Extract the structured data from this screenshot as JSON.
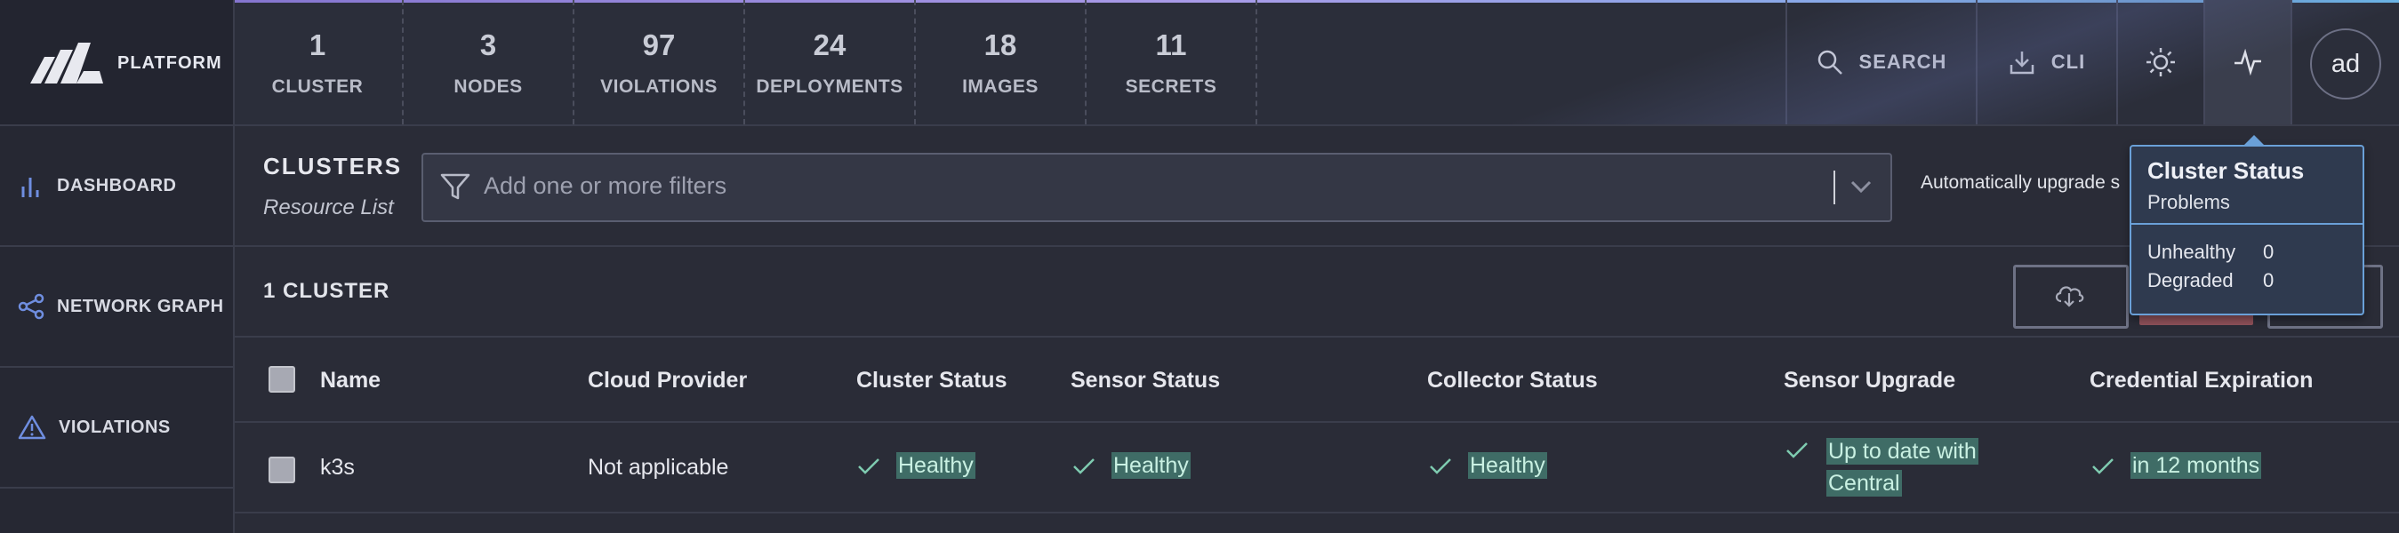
{
  "brand": {
    "label": "PLATFORM"
  },
  "summary": [
    {
      "count": "1",
      "label": "CLUSTER"
    },
    {
      "count": "3",
      "label": "NODES"
    },
    {
      "count": "97",
      "label": "VIOLATIONS"
    },
    {
      "count": "24",
      "label": "DEPLOYMENTS"
    },
    {
      "count": "18",
      "label": "IMAGES"
    },
    {
      "count": "11",
      "label": "SECRETS"
    }
  ],
  "topnav": {
    "search": "SEARCH",
    "cli": "CLI",
    "user_initials": "ad"
  },
  "sidebar": {
    "items": [
      {
        "label": "DASHBOARD"
      },
      {
        "label": "NETWORK GRAPH"
      },
      {
        "label": "VIOLATIONS"
      }
    ]
  },
  "page": {
    "title": "CLUSTERS",
    "subtitle": "Resource List",
    "filter_placeholder": "Add one or more filters",
    "auto_upgrade": "Automatically upgrade s",
    "count_label": "1 CLUSTER"
  },
  "table": {
    "headers": [
      "Name",
      "Cloud Provider",
      "Cluster Status",
      "Sensor Status",
      "Collector Status",
      "Sensor Upgrade",
      "Credential Expiration"
    ],
    "rows": [
      {
        "name": "k3s",
        "cloud_provider": "Not applicable",
        "cluster_status": "Healthy",
        "sensor_status": "Healthy",
        "collector_status": "Healthy",
        "sensor_upgrade_line1": "Up to date with",
        "sensor_upgrade_line2": "Central",
        "credential_expiration": "in 12 months"
      }
    ]
  },
  "tooltip": {
    "title": "Cluster Status",
    "subtitle": "Problems",
    "rows": [
      {
        "label": "Unhealthy",
        "value": "0"
      },
      {
        "label": "Degraded",
        "value": "0"
      }
    ]
  },
  "colors": {
    "healthy_bg": "#3f6c66",
    "accent": "#6aa0d8",
    "danger": "#8e5159"
  }
}
